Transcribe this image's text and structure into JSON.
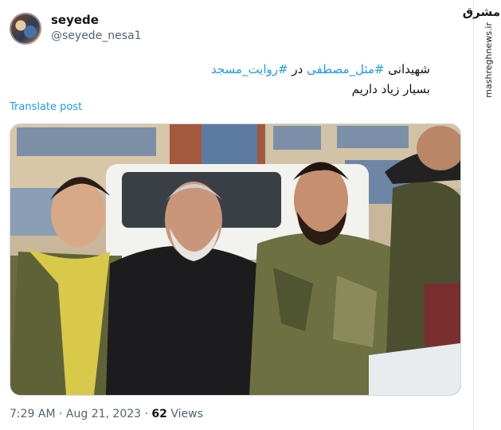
{
  "author": {
    "name": "seyede",
    "handle": "@seyede_nesa1"
  },
  "tweet": {
    "line1_part1": "شهیدانی ",
    "line1_hashtag1": "#مثل_مصطفی",
    "line1_part2": " در ",
    "line1_hashtag2": "#روایت_مسجد",
    "line2": "بسیار زیاد داریم"
  },
  "translate_label": "Translate post",
  "meta": {
    "time": "7:29 AM",
    "separator": " · ",
    "date": "Aug 21, 2023",
    "views_count": "62",
    "views_label": " Views"
  },
  "watermark": {
    "logo": "مشرق",
    "site": "mashreghnews.ir"
  },
  "icons": {
    "avatar": "user-avatar"
  },
  "colors": {
    "link": "#1d9bf0",
    "muted": "#536471",
    "text": "#0f1419"
  }
}
